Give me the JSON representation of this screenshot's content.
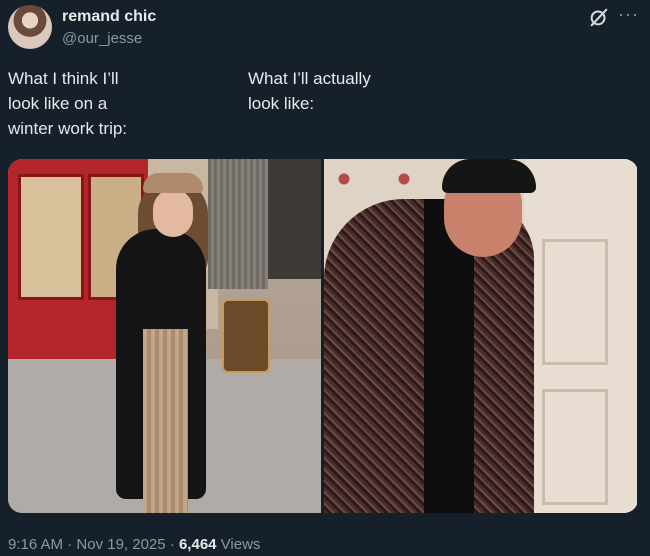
{
  "author": {
    "display_name": "remand chic",
    "handle": "@our_jesse",
    "avatar_icon": "profile-photo"
  },
  "header_icons": {
    "grok": "grok-icon",
    "more": "more-icon"
  },
  "tweet": {
    "caption_left": "What I think I’ll\nlook like on a\nwinter work trip:",
    "caption_right": "What I’ll actually\nlook like:"
  },
  "media": {
    "left_image": "woman in black coat, beret and plaid trousers on a city street",
    "right_image": "man in tweed coat, black scarf and hat by a door"
  },
  "footer": {
    "time": "9:16 AM",
    "separator": " · ",
    "date": "Nov 19, 2025",
    "views_count": "6,464",
    "views_label": " Views"
  },
  "colors": {
    "background": "#15202b",
    "text_primary": "#e7e9ea",
    "text_secondary": "#8b98a5"
  }
}
